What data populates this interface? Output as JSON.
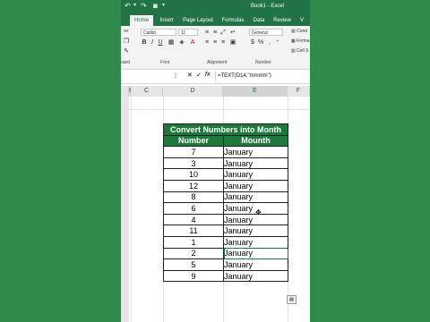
{
  "titlebar": {
    "title": "Book1 - Excel",
    "undo_icon": "undo-icon",
    "redo_icon": "redo-icon",
    "camera_icon": "camera-icon"
  },
  "ribbon_tabs": [
    "Home",
    "Insert",
    "Page Layout",
    "Formulas",
    "Data",
    "Review",
    "V"
  ],
  "ribbon": {
    "font_name": "Calibri",
    "font_size": "11",
    "number_format": "General",
    "cond_format_label": "Cond",
    "format_table_label": "Forma",
    "cell_styles_label": "Cell S",
    "group_clipboard": "oard",
    "group_font": "Font",
    "group_alignment": "Alignment",
    "group_number": "Number",
    "currency_symbol": "$",
    "percent_symbol": "%"
  },
  "formula_bar": {
    "formula": "=TEXT(D14,\"mmmm\")"
  },
  "columns": [
    "B",
    "C",
    "D",
    "E",
    "F"
  ],
  "table": {
    "title": "Convert Numbers into Month",
    "headers": [
      "Number",
      "Mounth"
    ],
    "rows": [
      [
        "7",
        "January"
      ],
      [
        "3",
        "January"
      ],
      [
        "10",
        "January"
      ],
      [
        "12",
        "January"
      ],
      [
        "8",
        "January"
      ],
      [
        "6",
        "January"
      ],
      [
        "4",
        "January"
      ],
      [
        "11",
        "January"
      ],
      [
        "1",
        "January"
      ],
      [
        "2",
        "January"
      ],
      [
        "5",
        "January"
      ],
      [
        "9",
        "January"
      ]
    ]
  }
}
